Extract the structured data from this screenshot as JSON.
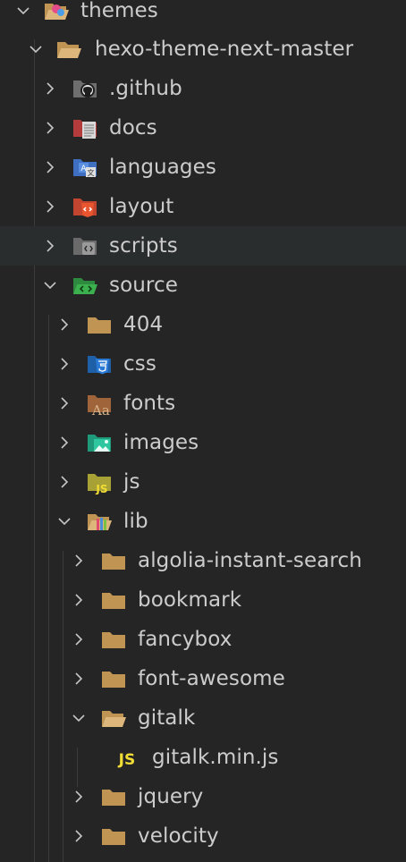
{
  "explorer": {
    "themes": "themes",
    "hexo": "hexo-theme-next-master",
    "github": ".github",
    "docs": "docs",
    "languages": "languages",
    "layout": "layout",
    "scripts": "scripts",
    "source": "source",
    "f404": "404",
    "css": "css",
    "fonts": "fonts",
    "images": "images",
    "js": "js",
    "lib": "lib",
    "algolia": "algolia-instant-search",
    "bookmark": "bookmark",
    "fancybox": "fancybox",
    "fontawesome": "font-awesome",
    "gitalk": "gitalk",
    "gitalkmin": "gitalk.min.js",
    "jquery": "jquery",
    "velocity": "velocity"
  },
  "colors": {
    "background": "#252526",
    "hover_row": "#2a2d2e",
    "text": "#cccccc",
    "folder": "#c09553",
    "js_yellow": "#f1dd35"
  },
  "icons": {
    "github_folder": "github-folder-icon",
    "docs_folder": "docs-folder-icon",
    "i18n_folder": "i18n-folder-icon",
    "layout_folder": "layout-folder-icon",
    "scripts_folder": "scripts-folder-icon",
    "source_folder": "source-folder-open-icon",
    "plain_folder": "folder-icon",
    "css_folder": "css-folder-icon",
    "fonts_folder": "fonts-folder-icon",
    "images_folder": "images-folder-icon",
    "js_folder": "js-folder-icon",
    "lib_folder": "lib-folder-open-icon",
    "js_file": "js-file-icon"
  }
}
